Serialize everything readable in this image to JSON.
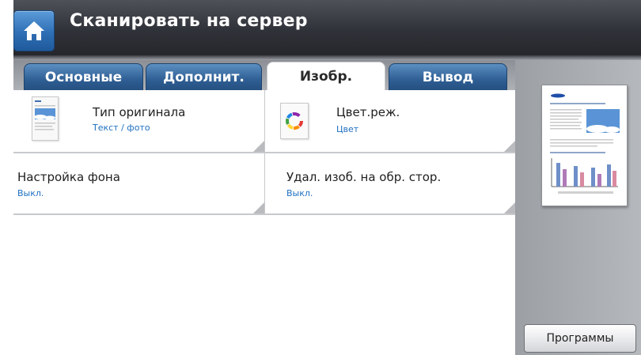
{
  "header": {
    "title": "Сканировать на сервер",
    "home_icon": "home-icon"
  },
  "tabs": [
    {
      "label": "Основные",
      "active": false
    },
    {
      "label": "Дополнит.",
      "active": false
    },
    {
      "label": "Изобр.",
      "active": true
    },
    {
      "label": "Вывод",
      "active": false
    }
  ],
  "settings": [
    {
      "label": "Тип оригинала",
      "value": "Текст / фото",
      "icon": "original-type-icon"
    },
    {
      "label": "Цвет.реж.",
      "value": "Цвет",
      "icon": "color-mode-icon"
    },
    {
      "label": "Настройка фона",
      "value": "Выкл."
    },
    {
      "label": "Удал. изоб. на обр. стор.",
      "value": "Выкл."
    }
  ],
  "sidebar": {
    "preview_icon": "document-preview-icon",
    "programs_label": "Программы"
  },
  "colors": {
    "accent": "#2f6fb5",
    "value_text": "#1e6fc0",
    "titlebar": "#2f3238"
  }
}
